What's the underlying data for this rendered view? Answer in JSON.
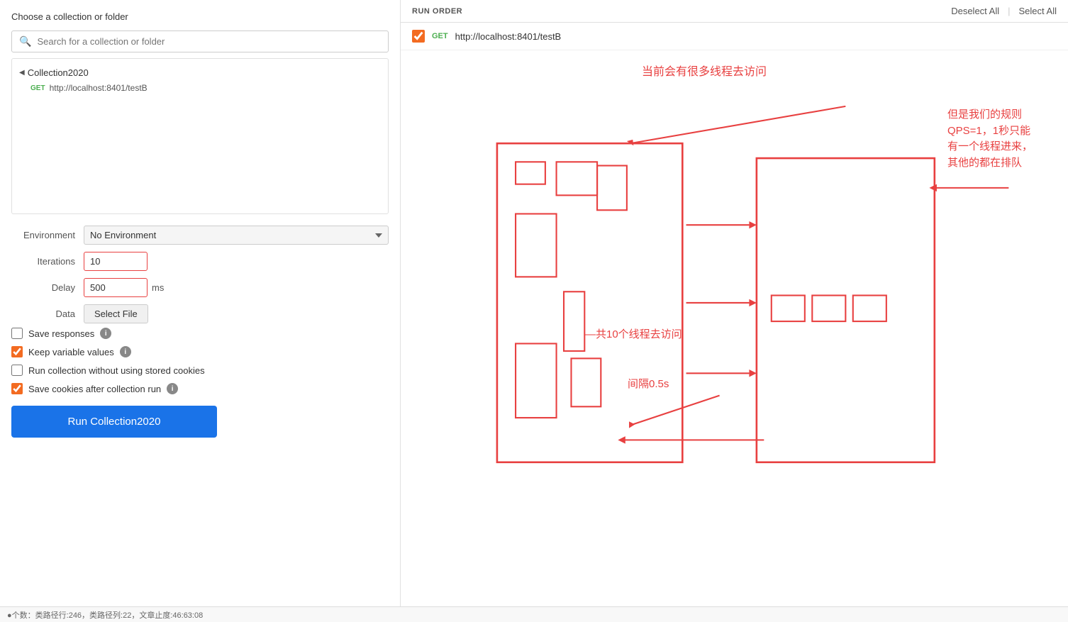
{
  "left": {
    "title": "Choose a collection or folder",
    "search_placeholder": "Search for a collection or folder",
    "collection_name": "Collection2020",
    "get_url": "http://localhost:8401/testB",
    "form": {
      "env_label": "Environment",
      "env_value": "No Environment",
      "iterations_label": "Iterations",
      "iterations_value": "10",
      "delay_label": "Delay",
      "delay_value": "500",
      "delay_unit": "ms",
      "data_label": "Data",
      "select_file_label": "Select File",
      "checkboxes": [
        {
          "id": "save-resp",
          "label": "Save responses",
          "checked": false,
          "has_info": true
        },
        {
          "id": "keep-var",
          "label": "Keep variable values",
          "checked": true,
          "has_info": true
        },
        {
          "id": "no-cookies",
          "label": "Run collection without using stored cookies",
          "checked": false,
          "has_info": false
        },
        {
          "id": "save-cookies",
          "label": "Save cookies after collection run",
          "checked": true,
          "has_info": true
        }
      ]
    },
    "run_button": "Run Collection2020"
  },
  "right": {
    "header": {
      "title": "RUN ORDER",
      "deselect_all": "Deselect All",
      "select_all": "Select All"
    },
    "requests": [
      {
        "method": "GET",
        "url": "http://localhost:8401/testB",
        "checked": true
      }
    ],
    "annotations": {
      "top_label": "当前会有很多线程去访问",
      "right_label": "但是我们的规则\nQPS=1，1秒只能\n有一个线程进来，\n其他的都在排队",
      "bottom_label": "—共10个线程去访问",
      "interval_label": "间隔0.5s"
    }
  },
  "status_bar": {
    "text": "●个数：类路径行:246，类路径列:22，文章止度:46:63:08"
  }
}
